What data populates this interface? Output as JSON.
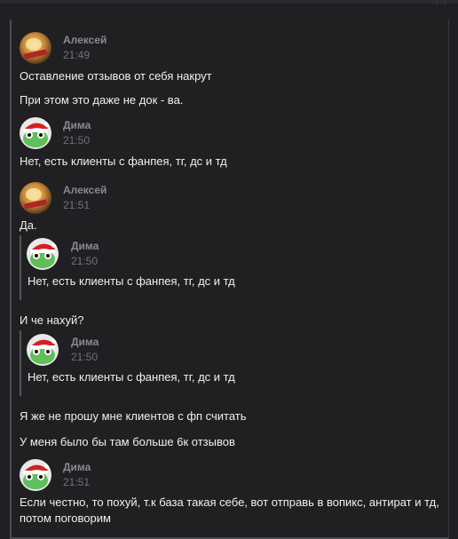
{
  "messages": {
    "m1": {
      "author": "Алексей",
      "time": "21:49",
      "lines": [
        "Оставление отзывов от себя накрут",
        "При этом это даже не док - ва."
      ]
    },
    "m2": {
      "author": "Дима",
      "time": "21:50",
      "lines": [
        "Нет, есть клиенты с фанпея, тг, дс и тд"
      ]
    },
    "m3": {
      "author": "Алексей",
      "time": "21:51",
      "line1": "Да.",
      "quote1": {
        "author": "Дима",
        "time": "21:50",
        "text": "Нет, есть клиенты с фанпея, тг, дс и тд"
      },
      "line2": "И че нахуй?",
      "quote2": {
        "author": "Дима",
        "time": "21:50",
        "text": "Нет, есть клиенты с фанпея, тг, дс и тд"
      },
      "line3": "Я же не прошу мне клиентов с фп считать",
      "line4": "У меня было бы там больше 6к отзывов"
    },
    "m4": {
      "author": "Дима",
      "time": "21:51",
      "text": "Если честно, то похуй, т.к база такая себе, вот отправь в вопикс, антират и тд, потом поговорим"
    }
  },
  "icons": {
    "alexey_avatar": "avatar-image",
    "dima_avatar": "avatar-frog-santa-hat"
  },
  "colors": {
    "background": "#202023",
    "text": "#f0f0f0",
    "meta": "#8a8a8f"
  }
}
